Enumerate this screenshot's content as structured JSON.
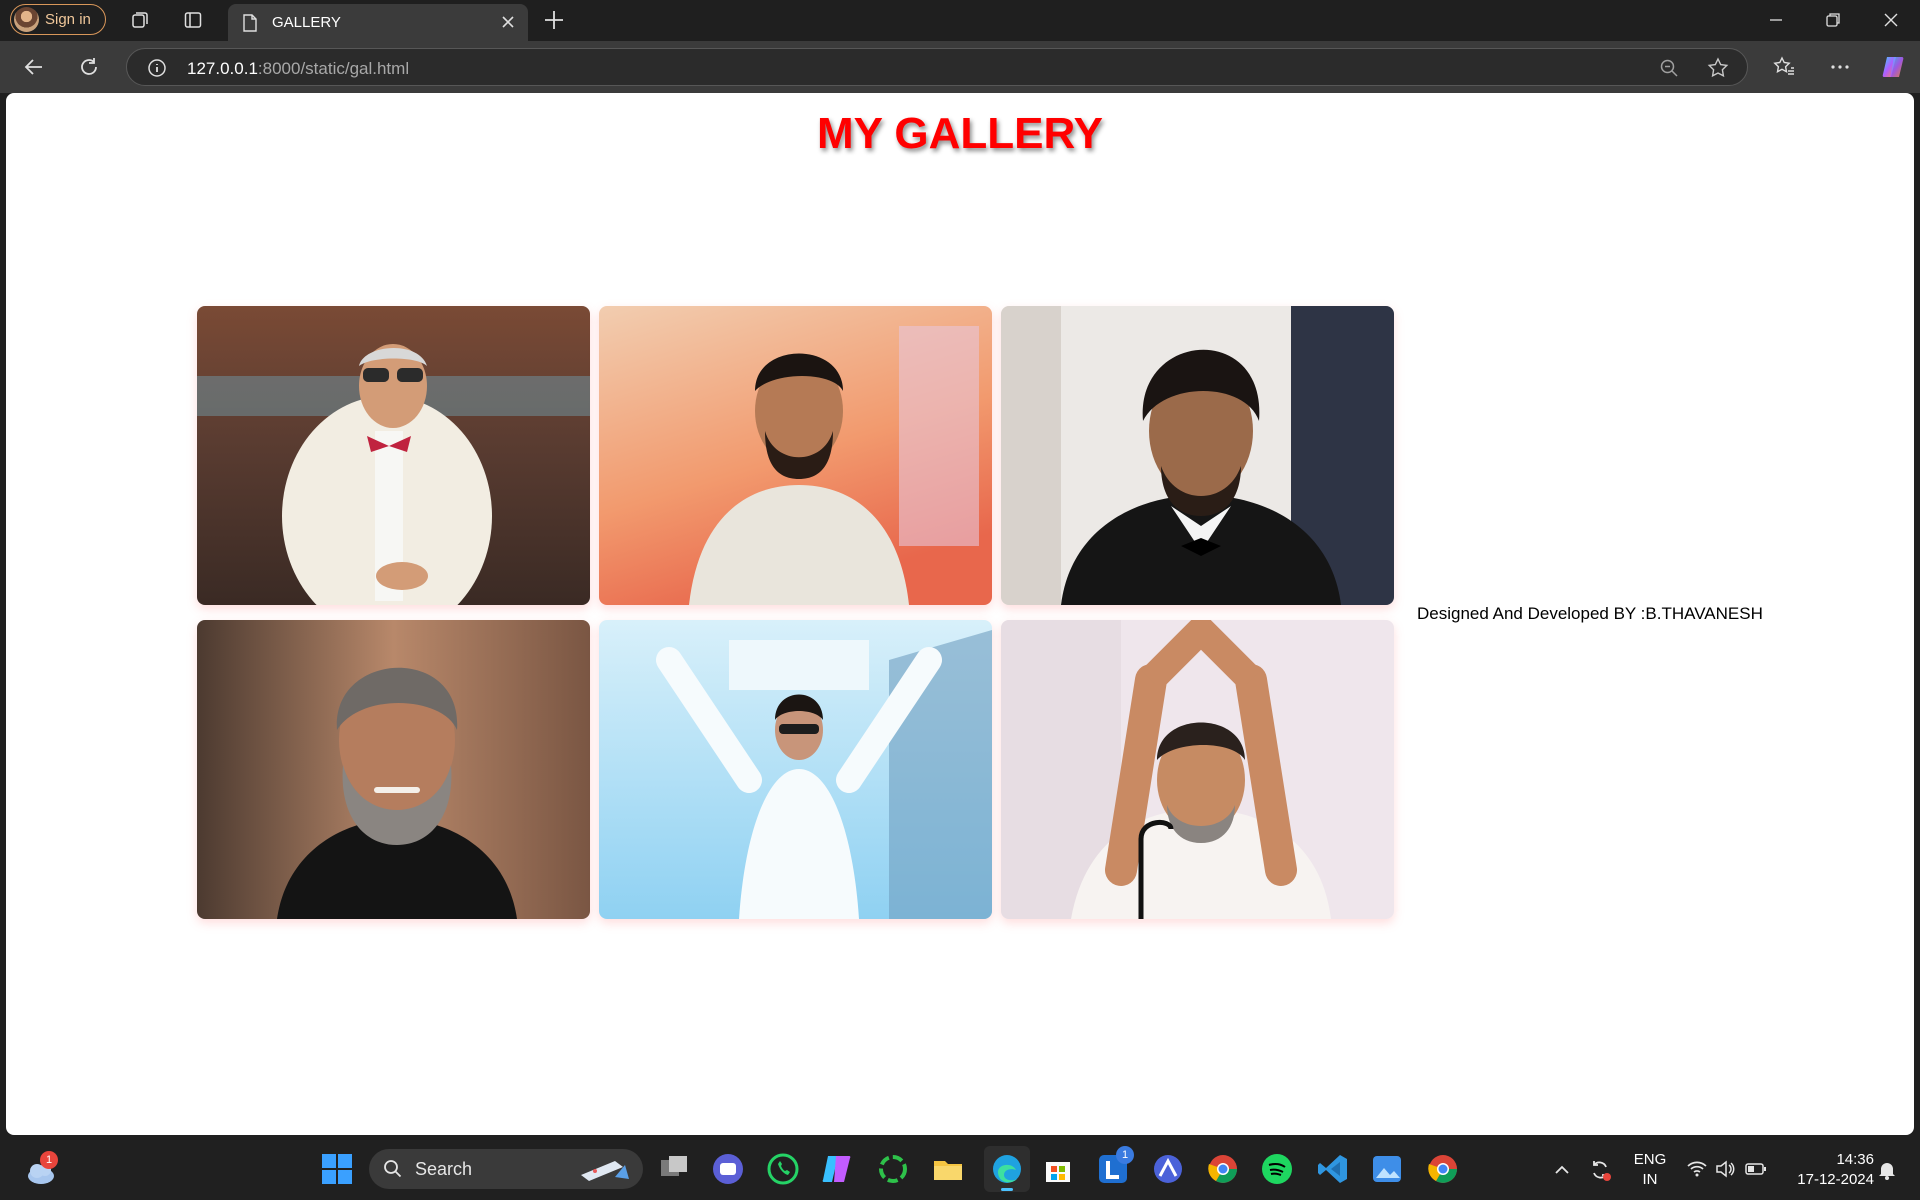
{
  "browser": {
    "signin_label": "Sign in",
    "tab_title": "GALLERY",
    "url_host": "127.0.0.1",
    "url_path": ":8000/static/gal.html"
  },
  "page": {
    "title": "MY GALLERY",
    "credit": "Designed And Developed BY :B.THAVANESH",
    "photos": [
      {
        "subject": "man in white suit with bow tie and sunglasses"
      },
      {
        "subject": "bearded man in light shirt, orange background"
      },
      {
        "subject": "smiling man in black tuxedo"
      },
      {
        "subject": "man with grey beard smiling"
      },
      {
        "subject": "man in white suit, arms raised, blue background"
      },
      {
        "subject": "man with hands joined above head at microphone"
      }
    ]
  },
  "taskbar": {
    "search_label": "Search",
    "language_line1": "ENG",
    "language_line2": "IN",
    "time": "14:36",
    "date": "17-12-2024",
    "weather_badge": "1",
    "app_badge": "1"
  }
}
